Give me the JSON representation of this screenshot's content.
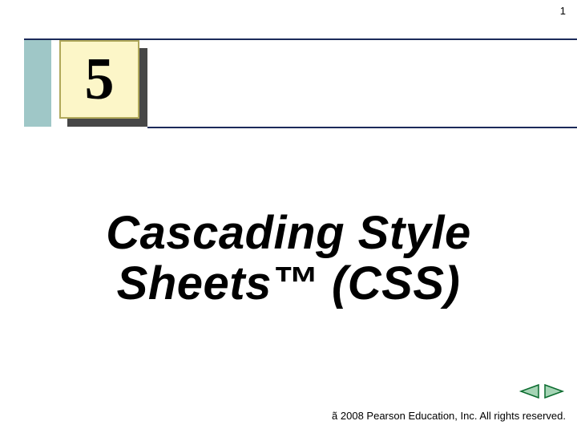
{
  "page_number": "1",
  "chapter_number": "5",
  "title_html": "Cascading Style<br>Sheets&#8482; (CSS)",
  "copyright": "ã 2008 Pearson Education, Inc.  All rights reserved.",
  "colors": {
    "rule": "#1b2a5a",
    "side_band": "#9fc7c7",
    "chapter_bg": "#fcf6c8",
    "chapter_border": "#b0a85a",
    "arrow_fill": "#a5d4b5",
    "arrow_stroke": "#0a6b2e"
  }
}
